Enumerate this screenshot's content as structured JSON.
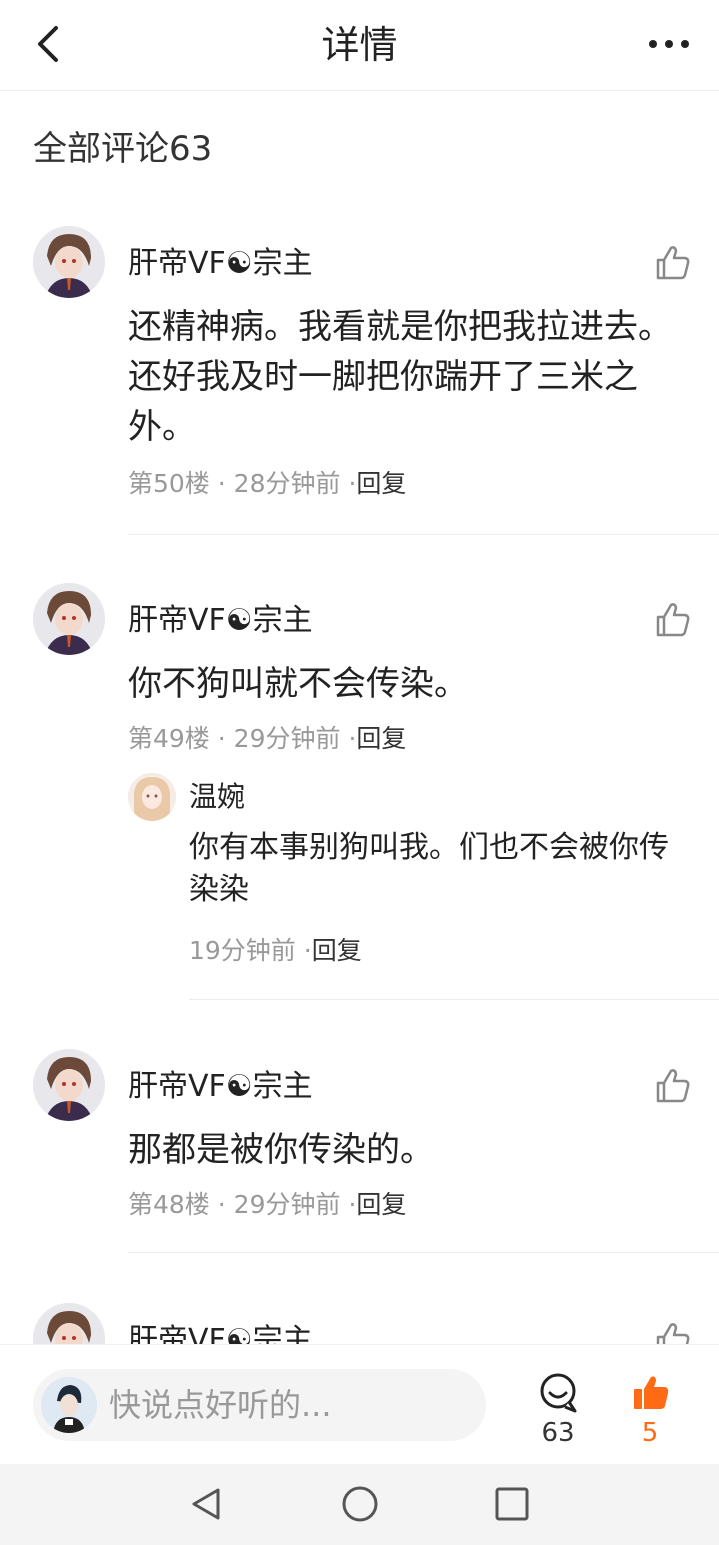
{
  "header": {
    "title": "详情"
  },
  "comments_section": {
    "title": "全部评论63"
  },
  "comments": [
    {
      "author": "肝帝VF☯宗主",
      "content": "还精神病。我看就是你把我拉进去。还好我及时一脚把你踹开了三米之外。",
      "floor": "第50楼",
      "time": "28分钟前",
      "reply_label": "回复"
    },
    {
      "author": "肝帝VF☯宗主",
      "content": "你不狗叫就不会传染。",
      "floor": "第49楼",
      "time": "29分钟前",
      "reply_label": "回复",
      "reply": {
        "author": "温婉",
        "content": "你有本事别狗叫我。们也不会被你传染染",
        "time": "19分钟前",
        "reply_label": "回复"
      }
    },
    {
      "author": "肝帝VF☯宗主",
      "content": "那都是被你传染的。",
      "floor": "第48楼",
      "time": "29分钟前",
      "reply_label": "回复"
    },
    {
      "author": "肝帝VF☯宗主"
    }
  ],
  "bottom_bar": {
    "input_placeholder": "快说点好听的...",
    "comment_count": "63",
    "like_count": "5"
  },
  "colors": {
    "accent": "#ff6a14",
    "muted_text": "#999999"
  },
  "icons": [
    "back-icon",
    "more-icon",
    "thumb-up-icon",
    "comment-bubble-icon",
    "thumb-up-filled-icon",
    "nav-back-icon",
    "nav-home-icon",
    "nav-recents-icon"
  ]
}
